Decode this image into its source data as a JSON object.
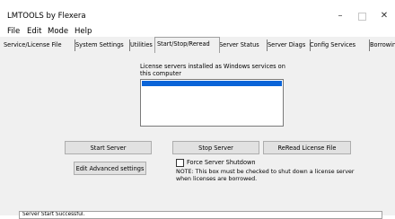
{
  "window": {
    "title": "LMTOOLS by Flexera",
    "minimize_label": "–",
    "close_label": "✕"
  },
  "menu": [
    "File",
    "Edit",
    "Mode",
    "Help"
  ],
  "tabs": [
    "Service/License File",
    "System Settings",
    "Utilities",
    "Start/Stop/Reread",
    "Server Status",
    "Server Diags",
    "Config Services",
    "Borrowing"
  ],
  "active_tab": "Start/Stop/Reread",
  "panel": {
    "services_label": "License servers installed as Windows services on this computer",
    "services_list": {
      "selected_item": ""
    },
    "buttons": {
      "start_server": "Start Server",
      "stop_server": "Stop Server",
      "reread_license": "ReRead License File",
      "edit_advanced": "Edit Advanced settings"
    },
    "force_shutdown": {
      "label": "Force Server Shutdown",
      "checked": false
    },
    "note": "NOTE:  This box must be checked to shut down a license server when licenses are borrowed."
  },
  "status_bar": {
    "text": "Server Start Successful."
  },
  "colors": {
    "selection": "#0a64d8",
    "panel_bg": "#f0f0f0",
    "button_bg": "#e1e1e1"
  }
}
